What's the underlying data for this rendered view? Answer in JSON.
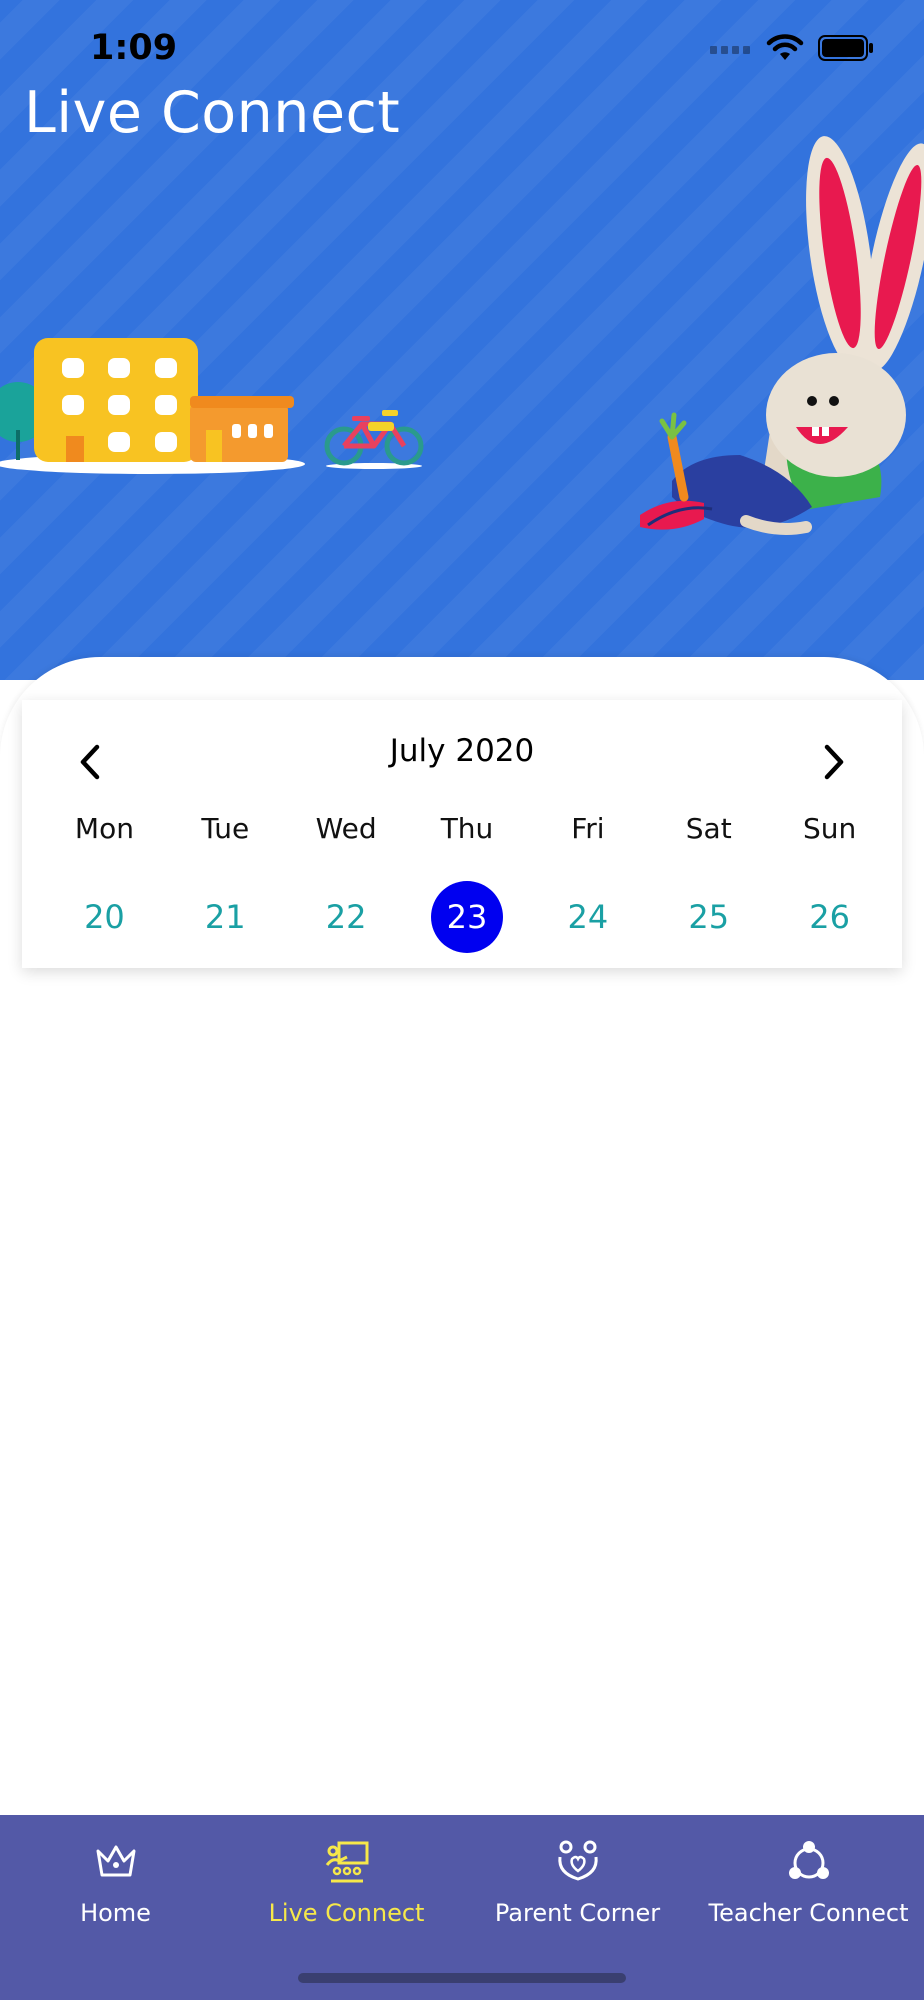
{
  "status_bar": {
    "time": "1:09"
  },
  "header": {
    "title": "Live Connect"
  },
  "calendar": {
    "month_label": "July 2020",
    "weekdays": [
      "Mon",
      "Tue",
      "Wed",
      "Thu",
      "Fri",
      "Sat",
      "Sun"
    ],
    "days": [
      "20",
      "21",
      "22",
      "23",
      "24",
      "25",
      "26"
    ],
    "selected_day": "23"
  },
  "tabbar": {
    "tabs": [
      {
        "label": "Home",
        "icon": "crown-icon"
      },
      {
        "label": "Live Connect",
        "icon": "classroom-icon"
      },
      {
        "label": "Parent Corner",
        "icon": "family-icon"
      },
      {
        "label": "Teacher Connect",
        "icon": "network-icon"
      }
    ],
    "active_tab": "Live Connect"
  },
  "colors": {
    "header_bg": "#3373dd",
    "selected_day": "#0000f0",
    "day_text": "#1aa0a4",
    "tabbar_bg": "#5359a7",
    "active_tab": "#f6e84a"
  }
}
